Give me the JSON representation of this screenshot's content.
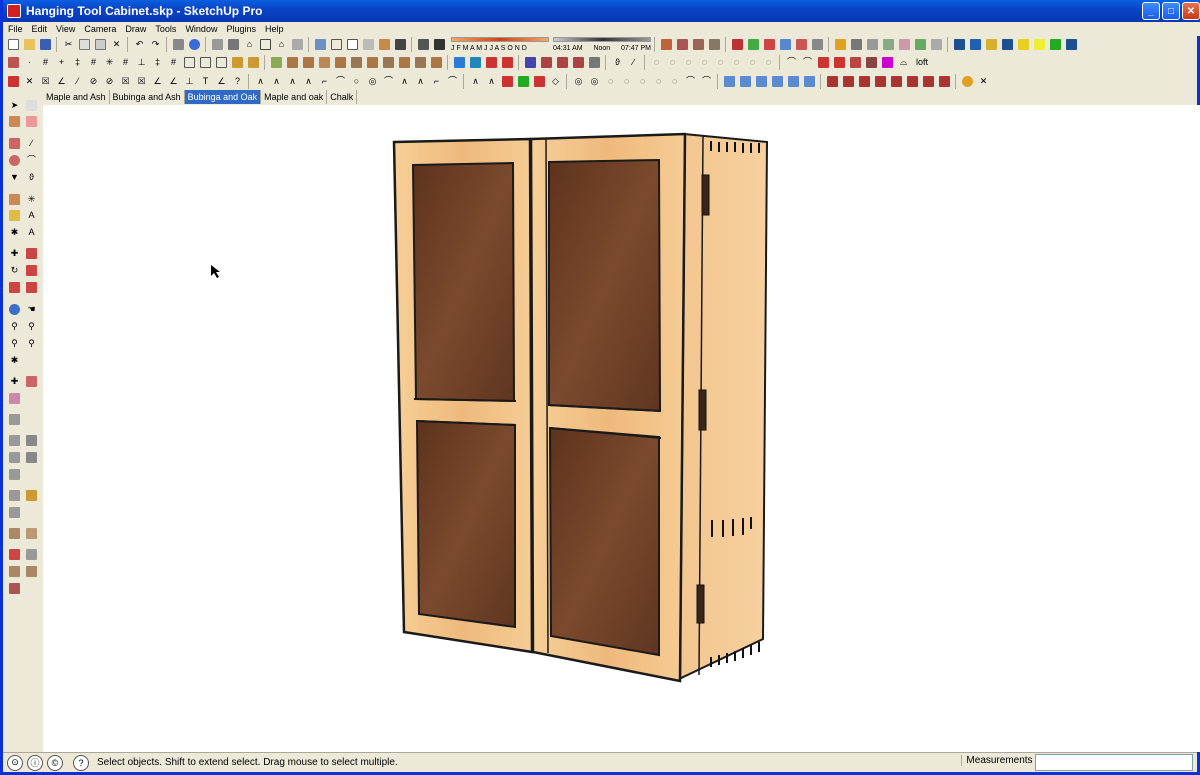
{
  "window": {
    "title": "Hanging Tool Cabinet.skp - SketchUp Pro",
    "app_icon": "sketchup-icon"
  },
  "menu": [
    "File",
    "Edit",
    "View",
    "Camera",
    "Draw",
    "Tools",
    "Window",
    "Plugins",
    "Help"
  ],
  "shadows": {
    "months": "J F M A M J J A S O N D",
    "time_start": "04:31 AM",
    "time_mid": "Noon",
    "time_end": "07:47 PM"
  },
  "toolbar_text": {
    "loft": "loft"
  },
  "scene_tabs": [
    {
      "label": "Maple and Ash",
      "active": false
    },
    {
      "label": "Bubinga and Ash",
      "active": false
    },
    {
      "label": "Bubinga and Oak",
      "active": true
    },
    {
      "label": "Maple and oak",
      "active": false
    },
    {
      "label": "Chalk",
      "active": false
    }
  ],
  "status": {
    "text": "Select objects. Shift to extend select. Drag mouse to select multiple.",
    "measurements_label": "Measurements",
    "measurements_value": ""
  },
  "colors": {
    "title_bar": "#0a44c8",
    "active_tab": "#316ac5",
    "frame_wood": "#f2c288",
    "panel_wood": "#6b3b22",
    "outline": "#1a1a1a"
  },
  "model": {
    "subject": "hanging-tool-cabinet"
  }
}
